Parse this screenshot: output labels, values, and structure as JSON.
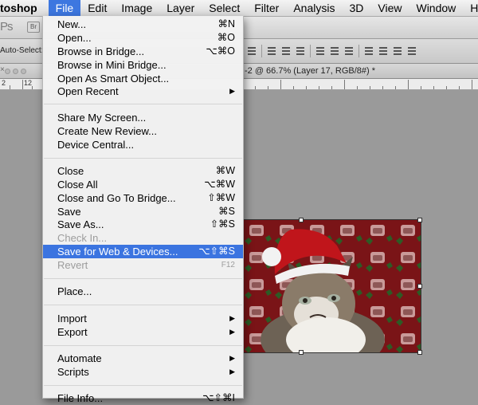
{
  "menubar": {
    "app": "toshop",
    "items": [
      "File",
      "Edit",
      "Image",
      "Layer",
      "Select",
      "Filter",
      "Analysis",
      "3D",
      "View",
      "Window",
      "Help"
    ]
  },
  "appbar": {
    "logo": "Ps",
    "bridge_button": "Br"
  },
  "optionsbar": {
    "auto_select": "Auto-Select:"
  },
  "doctab": {
    "title": "-2 @ 66.7% (Layer 17, RGB/8#) *"
  },
  "ruler": {
    "labels": [
      "2",
      "12"
    ]
  },
  "file_menu": {
    "items": [
      {
        "label": "New...",
        "shortcut": "⌘N"
      },
      {
        "label": "Open...",
        "shortcut": "⌘O"
      },
      {
        "label": "Browse in Bridge...",
        "shortcut": "⌥⌘O"
      },
      {
        "label": "Browse in Mini Bridge...",
        "shortcut": ""
      },
      {
        "label": "Open As Smart Object...",
        "shortcut": ""
      },
      {
        "label": "Open Recent",
        "shortcut": ""
      },
      {
        "label": "Share My Screen...",
        "shortcut": ""
      },
      {
        "label": "Create New Review...",
        "shortcut": ""
      },
      {
        "label": "Device Central...",
        "shortcut": ""
      },
      {
        "label": "Close",
        "shortcut": "⌘W"
      },
      {
        "label": "Close All",
        "shortcut": "⌥⌘W"
      },
      {
        "label": "Close and Go To Bridge...",
        "shortcut": "⇧⌘W"
      },
      {
        "label": "Save",
        "shortcut": "⌘S"
      },
      {
        "label": "Save As...",
        "shortcut": "⇧⌘S"
      },
      {
        "label": "Check In...",
        "shortcut": ""
      },
      {
        "label": "Save for Web & Devices...",
        "shortcut": "⌥⇧⌘S"
      },
      {
        "label": "Revert",
        "shortcut": "F12"
      },
      {
        "label": "Place...",
        "shortcut": ""
      },
      {
        "label": "Import",
        "shortcut": ""
      },
      {
        "label": "Export",
        "shortcut": ""
      },
      {
        "label": "Automate",
        "shortcut": ""
      },
      {
        "label": "Scripts",
        "shortcut": ""
      },
      {
        "label": "File Info...",
        "shortcut": "⌥⇧⌘I"
      }
    ]
  },
  "colors": {
    "highlight": "#3b74e0",
    "image_background": "#7a1417",
    "workspace": "#9a9a9a"
  }
}
